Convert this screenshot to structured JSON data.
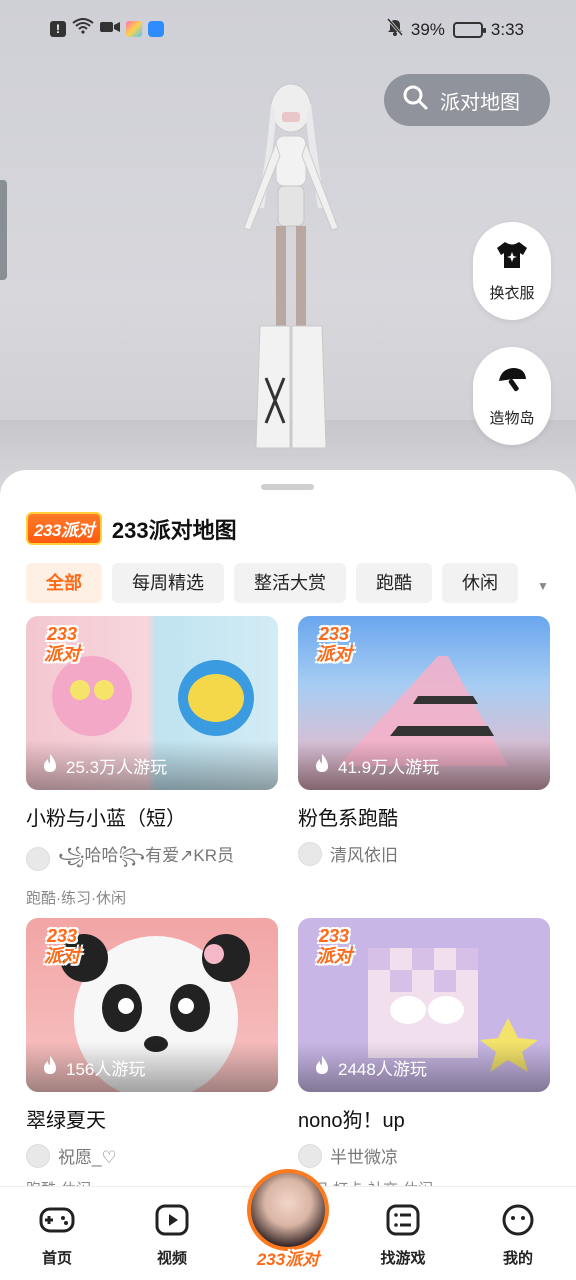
{
  "status_bar": {
    "battery": "39%",
    "time": "3:33"
  },
  "scene": {
    "map_button_label": "派对地图",
    "dress_up_label": "换衣服",
    "build_island_label": "造物岛"
  },
  "sheet": {
    "badge": "233派对",
    "title": "233派对地图",
    "tags": [
      "全部",
      "每周精选",
      "整活大赏",
      "跑酷",
      "休闲"
    ]
  },
  "cards": [
    {
      "badge": "233派对",
      "plays": "25.3万人游玩",
      "title": "小粉与小蓝（短）",
      "author": "꧁哈哈꧂有爱↗KR员",
      "tags": "跑酷·练习·休闲"
    },
    {
      "badge": "233派对",
      "plays": "41.9万人游玩",
      "title": "粉色系跑酷",
      "author": "清风依旧",
      "tags": ""
    },
    {
      "badge": "233派对",
      "plays": "156人游玩",
      "title": "翠绿夏天",
      "author": "祝愿_♡",
      "tags": "跑酷·休闲"
    },
    {
      "badge": "233派对",
      "plays": "2448人游玩",
      "title": "nono狗！up",
      "author": "半世微凉",
      "tags": "练习·打卡·社交·休闲"
    }
  ],
  "nav": {
    "home": "首页",
    "video": "视频",
    "center": "233派对",
    "find_games": "找游戏",
    "me": "我的"
  },
  "colors": {
    "accent": "#ff6a16",
    "active_tag_bg": "#fff0e6"
  }
}
